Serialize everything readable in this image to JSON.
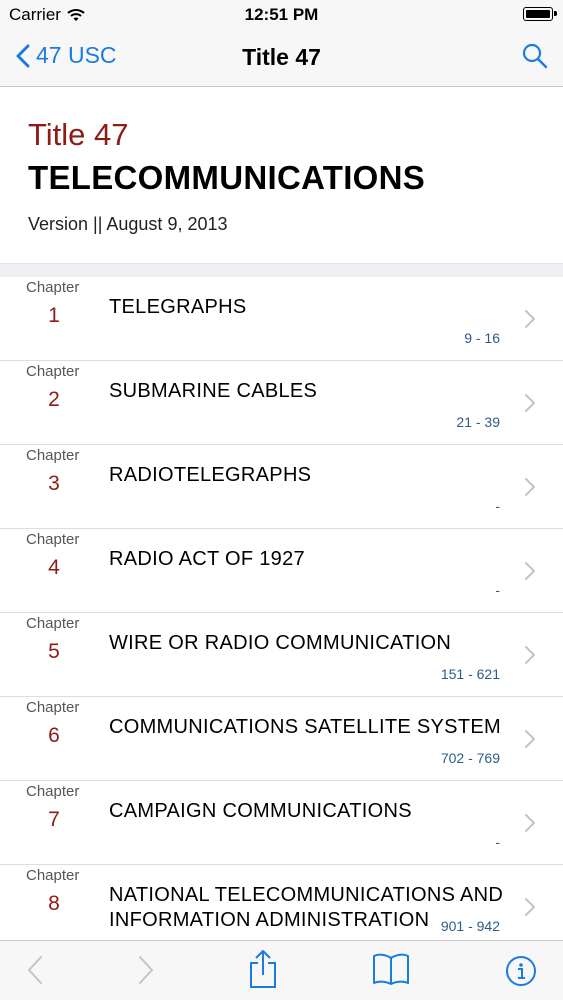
{
  "status": {
    "carrier": "Carrier",
    "time": "12:51 PM"
  },
  "nav": {
    "back_label": "47 USC",
    "title": "Title 47"
  },
  "header": {
    "title_line": "Title 47",
    "subtitle": "TELECOMMUNICATIONS",
    "version": "Version || August 9, 2013"
  },
  "chapter_label": "Chapter",
  "chapters": [
    {
      "num": "1",
      "name": "TELEGRAPHS",
      "range": "9 - 16"
    },
    {
      "num": "2",
      "name": "SUBMARINE CABLES",
      "range": "21 - 39"
    },
    {
      "num": "3",
      "name": "RADIOTELEGRAPHS",
      "range": "-"
    },
    {
      "num": "4",
      "name": "RADIO ACT OF 1927",
      "range": "-"
    },
    {
      "num": "5",
      "name": "WIRE OR RADIO COMMUNICATION",
      "range": "151 - 621"
    },
    {
      "num": "6",
      "name": "COMMUNICATIONS SATELLITE SYSTEM",
      "range": "702 - 769"
    },
    {
      "num": "7",
      "name": "CAMPAIGN COMMUNICATIONS",
      "range": "-"
    },
    {
      "num": "8",
      "name": "NATIONAL TELECOMMUNICATIONS AND INFORMATION ADMINISTRATION",
      "range": "901 - 942"
    }
  ],
  "toolbar": {
    "icons": [
      "back-arrow-icon",
      "forward-arrow-icon",
      "share-icon",
      "bookmarks-icon",
      "info-icon"
    ]
  },
  "colors": {
    "accent": "#1a7ce0",
    "chapter_red": "#8e1b16",
    "range_blue": "#2d5b8a"
  }
}
